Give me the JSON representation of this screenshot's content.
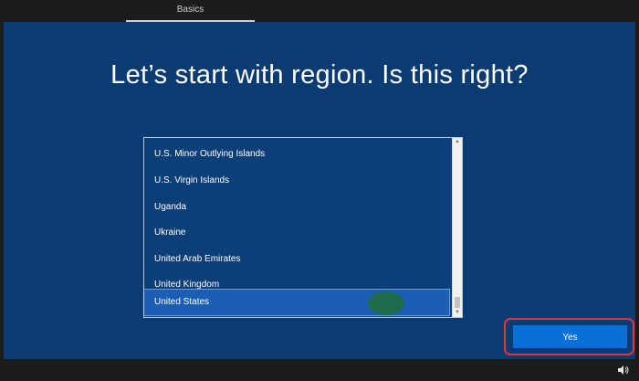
{
  "header": {
    "tab_label": "Basics"
  },
  "main": {
    "headline": "Let’s start with region. Is this right?"
  },
  "region_list": {
    "items": [
      "U.S. Minor Outlying Islands",
      "U.S. Virgin Islands",
      "Uganda",
      "Ukraine",
      "United Arab Emirates",
      "United Kingdom",
      "United States"
    ],
    "selected": "United States"
  },
  "actions": {
    "yes_label": "Yes"
  },
  "taskbar": {
    "icon": "speaker-icon"
  },
  "colors": {
    "background": "#0b3b73",
    "selection": "#1a5fb4",
    "button": "#0a6fd6",
    "highlight": "#e2343f"
  }
}
